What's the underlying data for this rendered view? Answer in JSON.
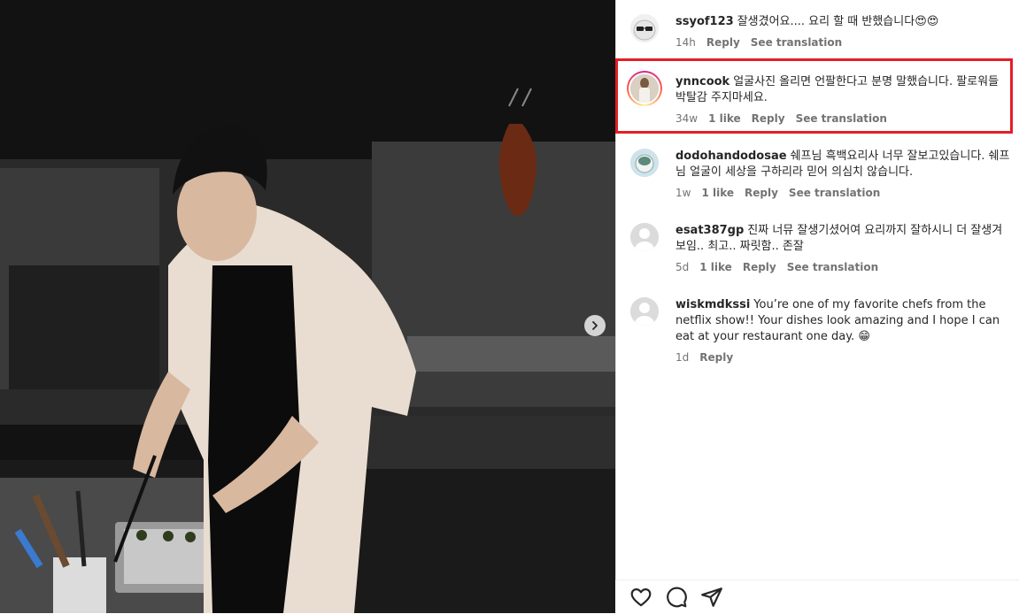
{
  "post": {
    "carousel_next_icon": "chevron-right-icon"
  },
  "comments": [
    {
      "username": "ssyof123",
      "text": "잘생겼어요.... 요리 할 때 반했습니다",
      "emoji": "😍😍",
      "time": "14h",
      "likes": "",
      "reply": "Reply",
      "translate": "See translation"
    },
    {
      "username": "ynncook",
      "text": "얼굴사진 올리면 언팔한다고 분명 말했습니다. 팔로워들 박탈감 주지마세요.",
      "emoji": "",
      "time": "34w",
      "likes": "1 like",
      "reply": "Reply",
      "translate": "See translation"
    },
    {
      "username": "dodohandodosae",
      "text": "쉐프님 흑백요리사 너무 잘보고있습니다. 쉐프님 얼굴이 세상을 구하리라 믿어 의심치 않습니다.",
      "emoji": "",
      "time": "1w",
      "likes": "1 like",
      "reply": "Reply",
      "translate": "See translation"
    },
    {
      "username": "esat387gp",
      "text": "진짜 너뮤 잘생기셨어여 요리까지 잘하시니 더 잘생겨보임.. 최고.. 짜릿함.. 존잘",
      "emoji": "",
      "time": "5d",
      "likes": "1 like",
      "reply": "Reply",
      "translate": "See translation"
    },
    {
      "username": "wiskmdkssi",
      "text": "You’re one of my favorite chefs from the netflix show!! Your dishes look amazing and I hope I can eat at your restaurant one day.",
      "emoji": "😁",
      "time": "1d",
      "likes": "",
      "reply": "Reply",
      "translate": ""
    }
  ],
  "actions": {
    "like_icon": "heart-icon",
    "comment_icon": "comment-icon",
    "share_icon": "send-icon"
  },
  "highlight_color": "#e31e24"
}
